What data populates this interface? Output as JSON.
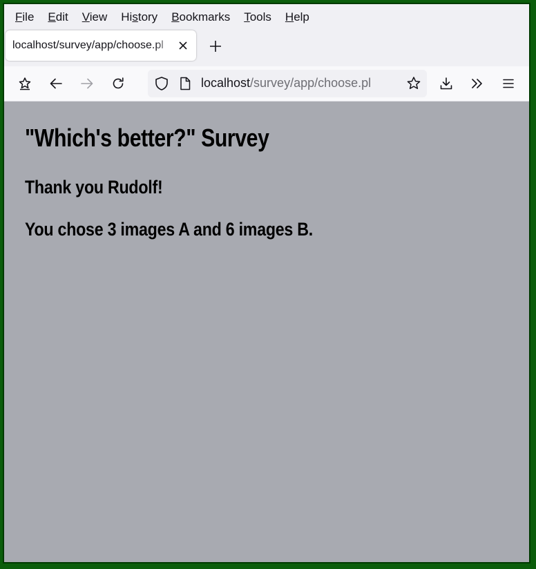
{
  "menubar": {
    "items": [
      {
        "accel": "F",
        "rest": "ile"
      },
      {
        "accel": "E",
        "rest": "dit"
      },
      {
        "accel": "V",
        "rest": "iew"
      },
      {
        "pre": "Hi",
        "accel": "s",
        "rest": "tory"
      },
      {
        "accel": "B",
        "rest": "ookmarks"
      },
      {
        "accel": "T",
        "rest": "ools"
      },
      {
        "accel": "H",
        "rest": "elp"
      }
    ]
  },
  "tab": {
    "title": "localhost/survey/app/choose.pl"
  },
  "url": {
    "host": "localhost",
    "path": "/survey/app/choose.pl"
  },
  "icons": {
    "tab_close": "close-icon",
    "new_tab": "plus-icon",
    "pocket": "save-to-pocket-icon",
    "back": "back-arrow-icon",
    "forward": "forward-arrow-icon",
    "reload": "reload-icon",
    "shield": "tracking-protection-shield-icon",
    "page": "page-info-icon",
    "bookmark": "bookmark-star-icon",
    "downloads": "download-icon",
    "overflow": "chevrons-right-icon",
    "menu": "hamburger-menu-icon"
  },
  "colors": {
    "frame": "#0b5d0b",
    "page_background": "#a8aab1"
  },
  "page": {
    "title": "\"Which's better?\" Survey",
    "thanks": "Thank you Rudolf!",
    "result": "You chose 3 images A and 6 images B."
  }
}
